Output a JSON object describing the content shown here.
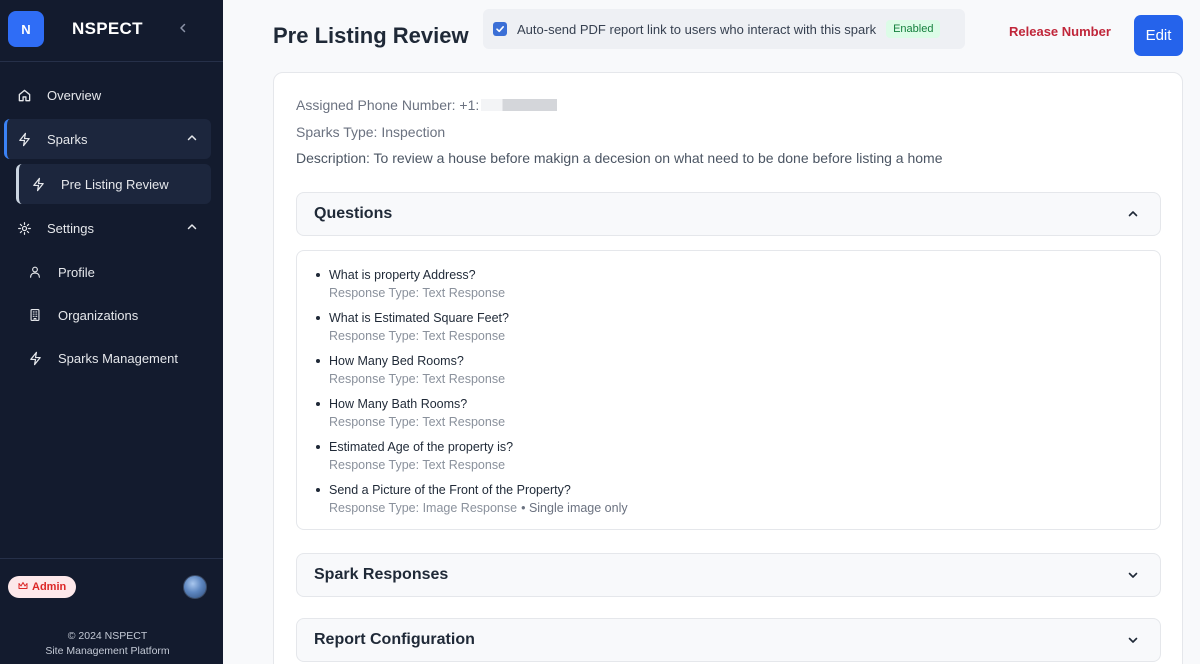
{
  "brand": {
    "logo_letter": "N",
    "name": "NSPECT"
  },
  "sidebar": {
    "overview": "Overview",
    "sparks": "Sparks",
    "sparks_child": "Pre Listing Review",
    "settings": "Settings",
    "settings_children": {
      "profile": "Profile",
      "organizations": "Organizations",
      "sparks_management": "Sparks Management"
    }
  },
  "footer": {
    "role_badge": "Admin",
    "copyright": "© 2024 NSPECT",
    "tagline": "Site Management Platform"
  },
  "header": {
    "title": "Pre Listing Review",
    "autosend_label": "Auto-send PDF report link to users who interact with this spark",
    "autosend_checked": true,
    "autosend_status": "Enabled",
    "release_link": "Release Number",
    "edit_button": "Edit"
  },
  "details": {
    "phone_label": "Assigned Phone Number: +1:",
    "type_line": "Sparks Type: Inspection",
    "description_line": "Description: To review a house before makign a decesion on what need to be done before listing a home"
  },
  "sections": {
    "questions": "Questions",
    "responses": "Spark Responses",
    "report": "Report Configuration"
  },
  "questions": [
    {
      "text": "What is property Address?",
      "type": "Response Type: Text Response"
    },
    {
      "text": "What is Estimated Square Feet?",
      "type": "Response Type: Text Response"
    },
    {
      "text": "How Many Bed Rooms?",
      "type": "Response Type: Text Response"
    },
    {
      "text": "How Many Bath Rooms?",
      "type": "Response Type: Text Response"
    },
    {
      "text": "Estimated Age of the property is?",
      "type": "Response Type: Text Response"
    },
    {
      "text": "Send a Picture of the Front of the Property?",
      "type": "Response Type: Image Response",
      "extra": "• Single image only"
    }
  ],
  "colors": {
    "sidebar_bg": "#131b2e",
    "accent": "#2563eb",
    "release_red": "#c0263a",
    "enabled_green": "#15803d"
  }
}
